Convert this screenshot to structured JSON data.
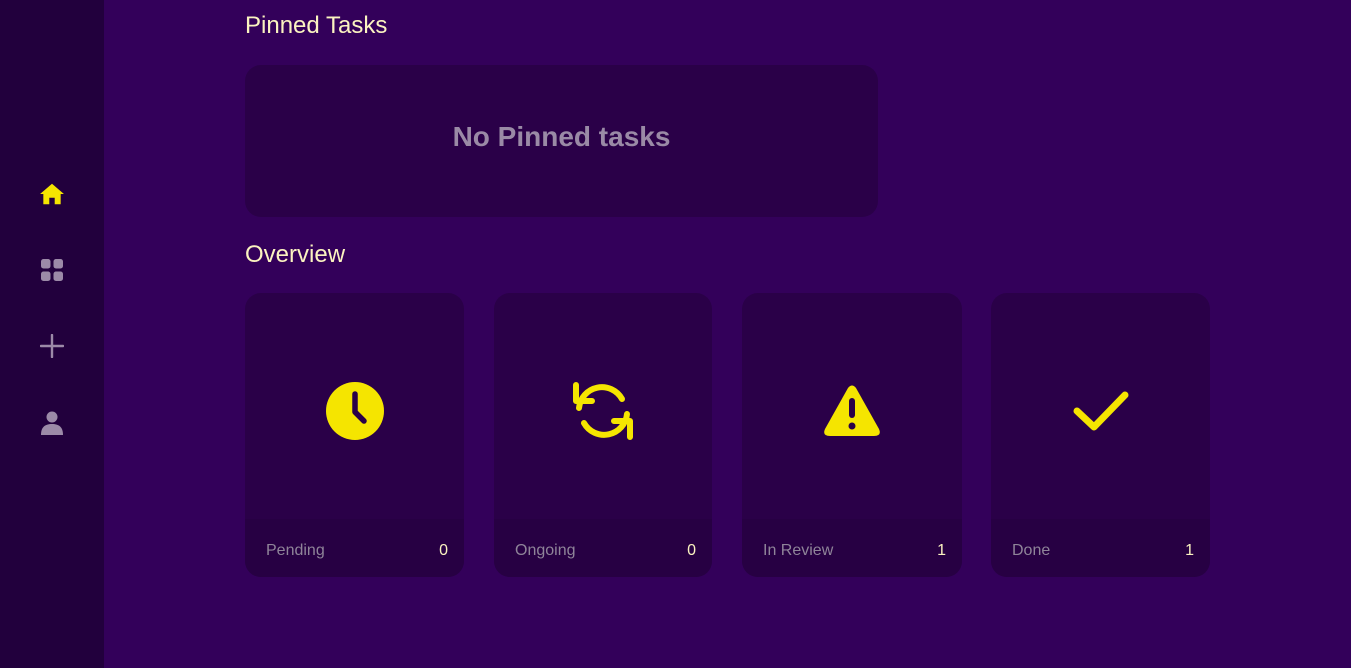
{
  "colors": {
    "accent": "#f5e500",
    "muted_icon": "#9c8aa8",
    "background": "#33005a",
    "sidebar": "#22003d",
    "card": "#2a0048"
  },
  "sidebar": {
    "items": [
      {
        "icon": "home-icon",
        "active": true
      },
      {
        "icon": "grid-icon",
        "active": false
      },
      {
        "icon": "plus-icon",
        "active": false
      },
      {
        "icon": "user-icon",
        "active": false
      }
    ]
  },
  "pinned": {
    "title": "Pinned Tasks",
    "empty_text": "No Pinned tasks"
  },
  "overview": {
    "title": "Overview",
    "cards": [
      {
        "icon": "clock-icon",
        "label": "Pending",
        "count": "0"
      },
      {
        "icon": "refresh-icon",
        "label": "Ongoing",
        "count": "0"
      },
      {
        "icon": "warning-icon",
        "label": "In Review",
        "count": "1"
      },
      {
        "icon": "check-icon",
        "label": "Done",
        "count": "1"
      }
    ]
  }
}
